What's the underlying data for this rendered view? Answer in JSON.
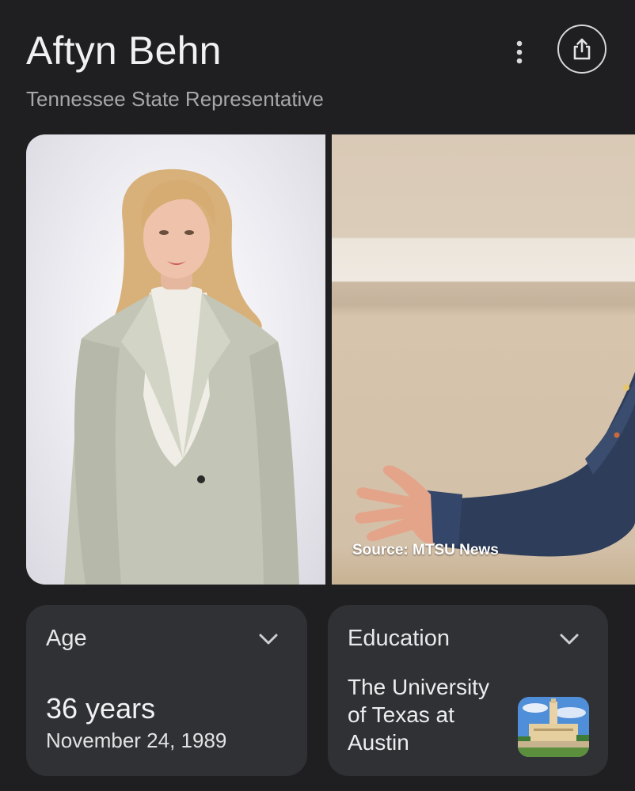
{
  "header": {
    "title": "Aftyn Behn",
    "subtitle": "Tennessee State Representative",
    "more_icon": "more-vert-icon",
    "share_icon": "share-icon"
  },
  "images": {
    "source_caption": "Source: MTSU News"
  },
  "cards": {
    "age": {
      "label": "Age",
      "value": "36 years",
      "sub": "November 24, 1989"
    },
    "education": {
      "label": "Education",
      "value": "The University of Texas at Austin"
    }
  },
  "colors": {
    "background": "#1f1f21",
    "card": "#303134",
    "primary_text": "#f1f1f3",
    "secondary_text": "#a7a7ab"
  }
}
